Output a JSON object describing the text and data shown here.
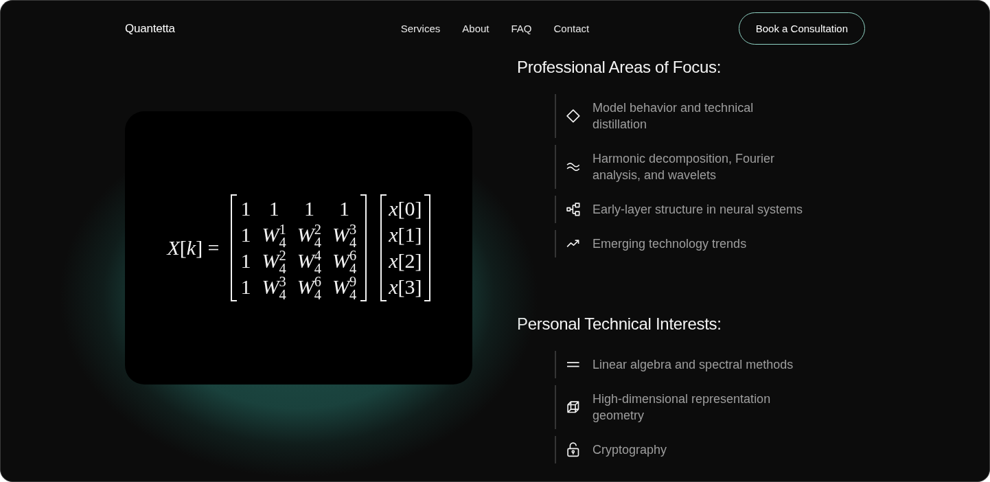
{
  "nav": {
    "logo": "Quantetta",
    "links": [
      "Services",
      "About",
      "FAQ",
      "Contact"
    ],
    "cta": "Book a Consultation"
  },
  "equation": {
    "lhs": "*X*[*k*] =",
    "matrix": [
      [
        "1",
        "1",
        "1",
        "1"
      ],
      [
        "1",
        "*W*$^{1}$$_{4}$",
        "*W*$^{2}$$_{4}$",
        "*W*$^{3}$$_{4}$"
      ],
      [
        "1",
        "*W*$^{2}$$_{4}$",
        "*W*$^{4}$$_{4}$",
        "*W*$^{6}$$_{4}$"
      ],
      [
        "1",
        "*W*$^{3}$$_{4}$",
        "*W*$^{6}$$_{4}$",
        "*W*$^{9}$$_{4}$"
      ]
    ],
    "vector": [
      "*x*[0]",
      "*x*[1]",
      "*x*[2]",
      "*x*[3]"
    ]
  },
  "sections": [
    {
      "heading": "Professional Areas of Focus:",
      "items": [
        {
          "kind": "diamond",
          "text": "Model behavior and technical distillation"
        },
        {
          "kind": "approx",
          "text": "Harmonic decomposition, Fourier analysis, and wavelets"
        },
        {
          "kind": "nodes",
          "text": "Early-layer structure in neural systems"
        },
        {
          "kind": "trend",
          "text": "Emerging technology trends"
        }
      ]
    },
    {
      "heading": "Personal Technical Interests:",
      "items": [
        {
          "kind": "equals",
          "text": "Linear algebra and spectral methods"
        },
        {
          "kind": "cube",
          "text": "High-dimensional representation geometry"
        },
        {
          "kind": "unlock",
          "text": "Cryptography"
        }
      ]
    }
  ]
}
